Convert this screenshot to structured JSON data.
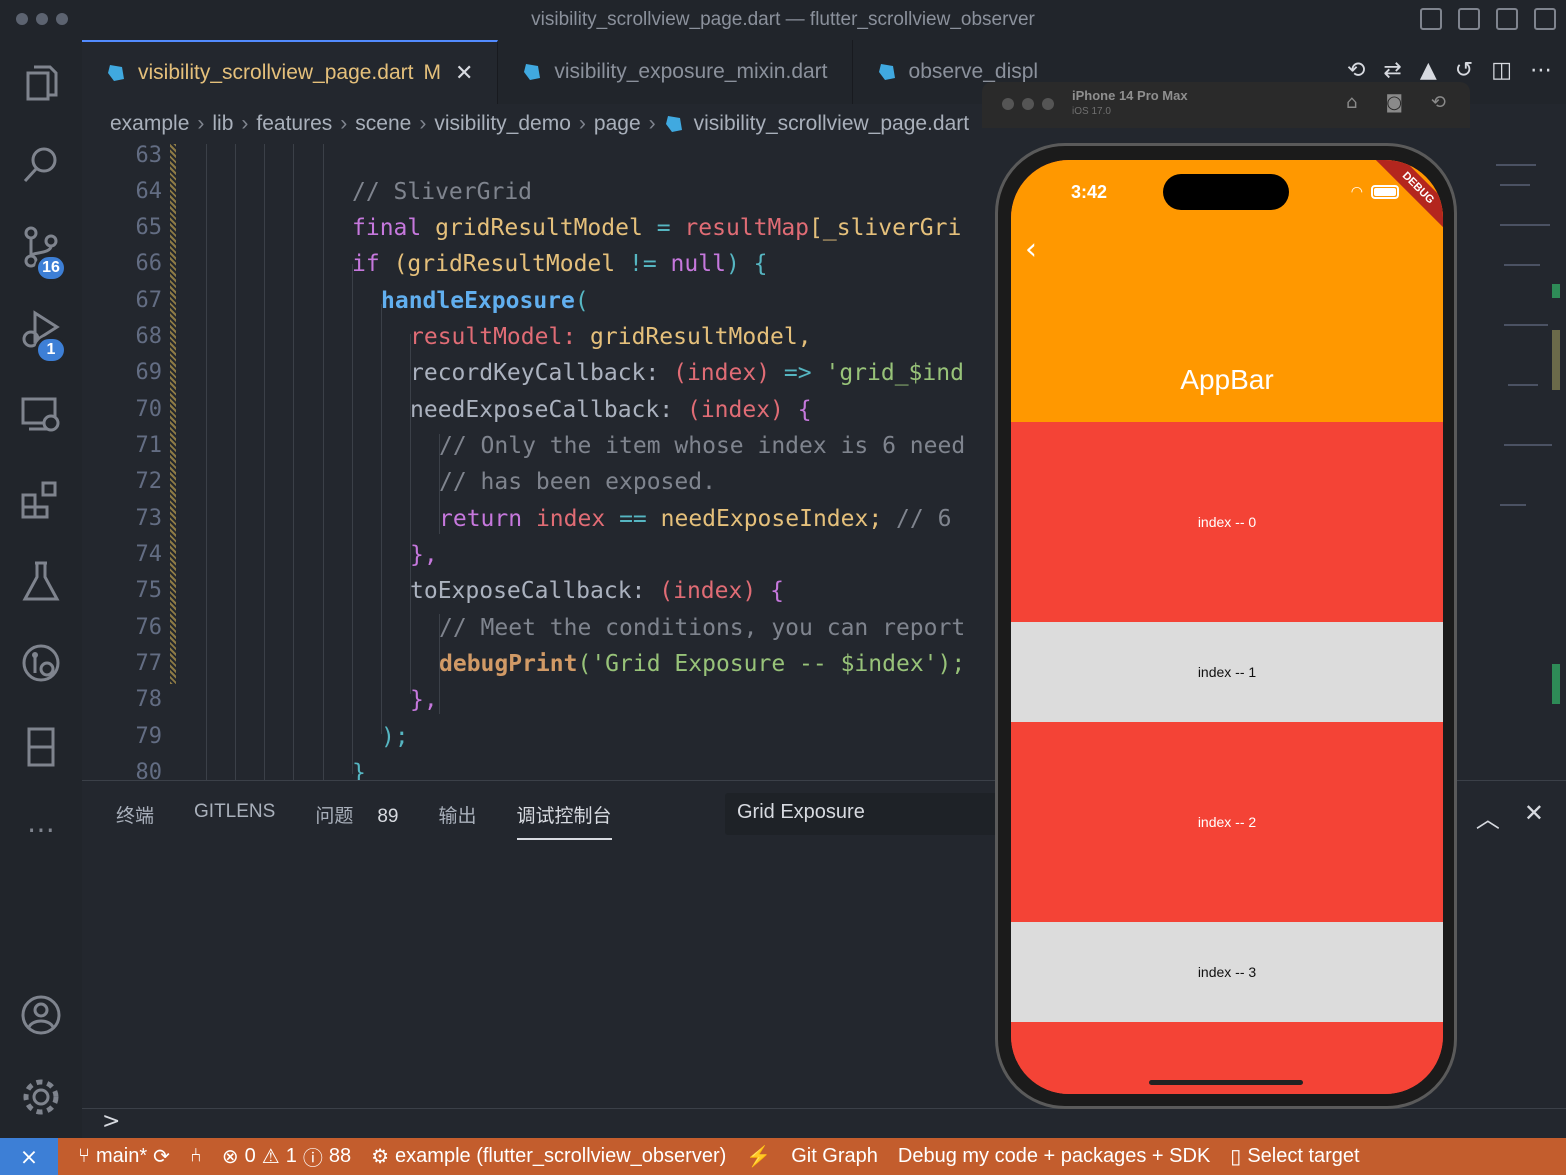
{
  "window": {
    "title": "visibility_scrollview_page.dart — flutter_scrollview_observer"
  },
  "activity": {
    "scm_badge": "16",
    "debug_badge": "1"
  },
  "tabs": [
    {
      "label": "visibility_scrollview_page.dart",
      "modified": "M",
      "close": "✕"
    },
    {
      "label": "visibility_exposure_mixin.dart"
    },
    {
      "label": "observe_displ"
    }
  ],
  "breadcrumb": [
    "example",
    "lib",
    "features",
    "scene",
    "visibility_demo",
    "page",
    "visibility_scrollview_page.dart"
  ],
  "code_lines": [
    {
      "n": "63"
    },
    {
      "n": "64"
    },
    {
      "n": "65"
    },
    {
      "n": "66"
    },
    {
      "n": "67"
    },
    {
      "n": "68"
    },
    {
      "n": "69"
    },
    {
      "n": "70"
    },
    {
      "n": "71"
    },
    {
      "n": "72"
    },
    {
      "n": "73"
    },
    {
      "n": "74"
    },
    {
      "n": "75"
    },
    {
      "n": "76"
    },
    {
      "n": "77"
    },
    {
      "n": "78"
    },
    {
      "n": "79"
    },
    {
      "n": "80"
    }
  ],
  "code": {
    "l64": "// SliverGrid",
    "l65_kw": "final",
    "l65_var": "gridResultModel",
    "l65_op": "=",
    "l65_prop": "resultMap",
    "l65_rest": "[_sliverGri",
    "l66_kw": "if",
    "l66_a": "(gridResultModel",
    "l66_op": "!=",
    "l66_b": "null",
    "l66_c": ") {",
    "l67_fn": "handleExposure",
    "l67_p": "(",
    "l68_p": "resultModel:",
    "l68_v": "gridResultModel,",
    "l69_a": "recordKeyCallback:",
    "l69_b": "(index)",
    "l69_c": "=>",
    "l69_d": "'grid_$ind",
    "l70_a": "needExposeCallback:",
    "l70_b": "(index)",
    "l70_c": "{",
    "l71": "// Only the item whose index is 6 need",
    "l72": "// has been exposed.",
    "l73_kw": "return",
    "l73_a": "index",
    "l73_op": "==",
    "l73_b": "needExposeIndex;",
    "l73_c": "// 6",
    "l74": "},",
    "l75_a": "toExposeCallback:",
    "l75_b": "(index)",
    "l75_c": "{",
    "l76": "// Meet the conditions, you can report",
    "l77_fn": "debugPrint",
    "l77_s": "('Grid Exposure -- $index');",
    "l78": "},",
    "l79": ");",
    "l80": "}"
  },
  "panel": {
    "tabs": [
      "终端",
      "GITLENS",
      "问题",
      "输出",
      "调试控制台"
    ],
    "problems_count": "89",
    "filter_value": "Grid Exposure",
    "prompt": ">"
  },
  "statusbar": {
    "branch": "main*",
    "errors": "0",
    "warnings": "1",
    "infos": "88",
    "debug_target": "example (flutter_scrollview_observer)",
    "git_graph": "Git Graph",
    "debug_mode": "Debug my code + packages + SDK",
    "select_target": "Select target"
  },
  "simulator": {
    "device": "iPhone 14 Pro Max",
    "os": "iOS 17.0",
    "time": "3:42",
    "debug_banner": "DEBUG",
    "appbar_title": "AppBar",
    "items": [
      "index -- 0",
      "index -- 1",
      "index -- 2",
      "index -- 3"
    ]
  },
  "colors": {
    "appbar": "#ff9800",
    "red_item": "#f44336",
    "grey_item": "#dcdcdc",
    "statusbar": "#c35d2d"
  }
}
